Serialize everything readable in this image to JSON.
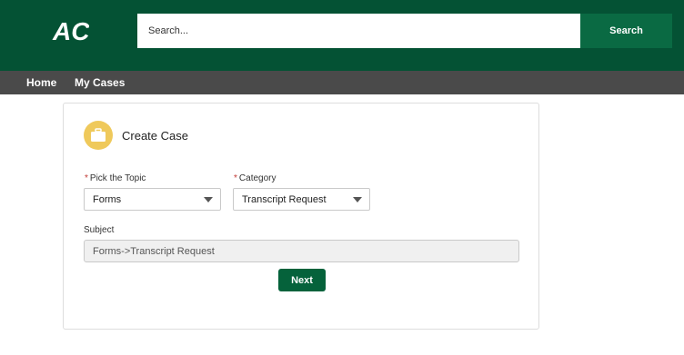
{
  "header": {
    "logo_text": "AC",
    "search_placeholder": "Search...",
    "search_button_label": "Search"
  },
  "nav": {
    "items": [
      {
        "label": "Home"
      },
      {
        "label": "My Cases"
      }
    ]
  },
  "card": {
    "title": "Create Case",
    "icon": "briefcase-icon",
    "topic": {
      "label": "Pick the Topic",
      "required_marker": "*",
      "value": "Forms"
    },
    "category": {
      "label": "Category",
      "required_marker": "*",
      "value": "Transcript Request"
    },
    "subject": {
      "label": "Subject",
      "value": "Forms->Transcript Request"
    },
    "next_label": "Next"
  },
  "colors": {
    "header_bg": "#045234",
    "nav_bg": "#4a4a4a",
    "accent_green": "#05623b",
    "icon_yellow": "#efc95b",
    "required_red": "#c23934"
  }
}
